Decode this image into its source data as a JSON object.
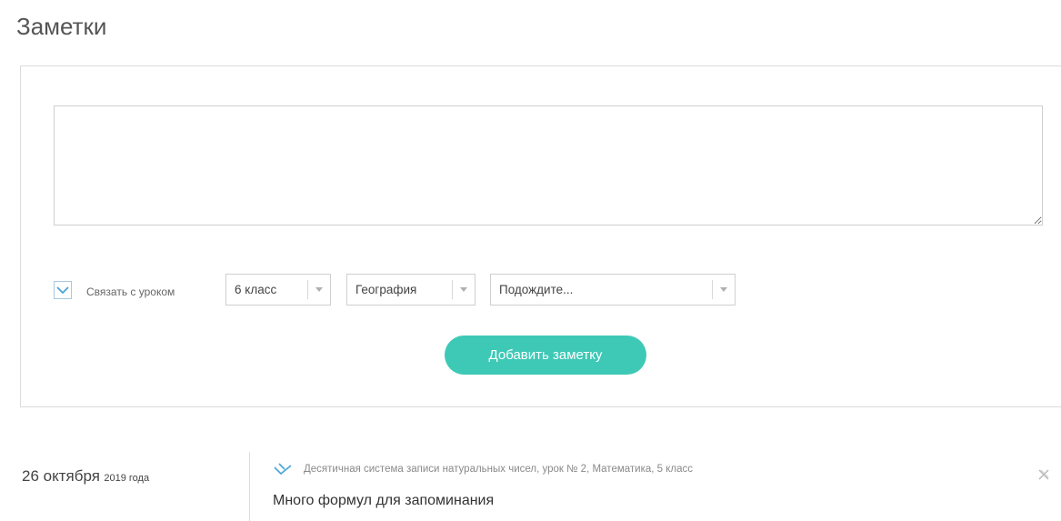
{
  "page": {
    "title": "Заметки"
  },
  "form": {
    "note_text_value": "",
    "link_checkbox": {
      "checked": true,
      "label": "Связать с уроком"
    },
    "class_select": {
      "value": "6 класс"
    },
    "subject_select": {
      "value": "География"
    },
    "lesson_select": {
      "value": "Подождите..."
    },
    "add_button_label": "Добавить заметку"
  },
  "notes": [
    {
      "date_day": "26 октября",
      "date_year": "2019 года",
      "lesson": "Десятичная система записи натуральных чисел, урок № 2, Математика, 5 класс",
      "text": "Много формул для запоминания"
    }
  ],
  "icons": {
    "checkbox": "checkmark-icon",
    "select_arrow": "chevron-down-icon",
    "note_pin": "pin-icon",
    "note_delete": "delete-icon"
  },
  "colors": {
    "accent": "#3ec9b6",
    "checkbox_border": "#a8c8df",
    "checkmark": "#4aa3d8",
    "pin": "#4aa3d8"
  }
}
